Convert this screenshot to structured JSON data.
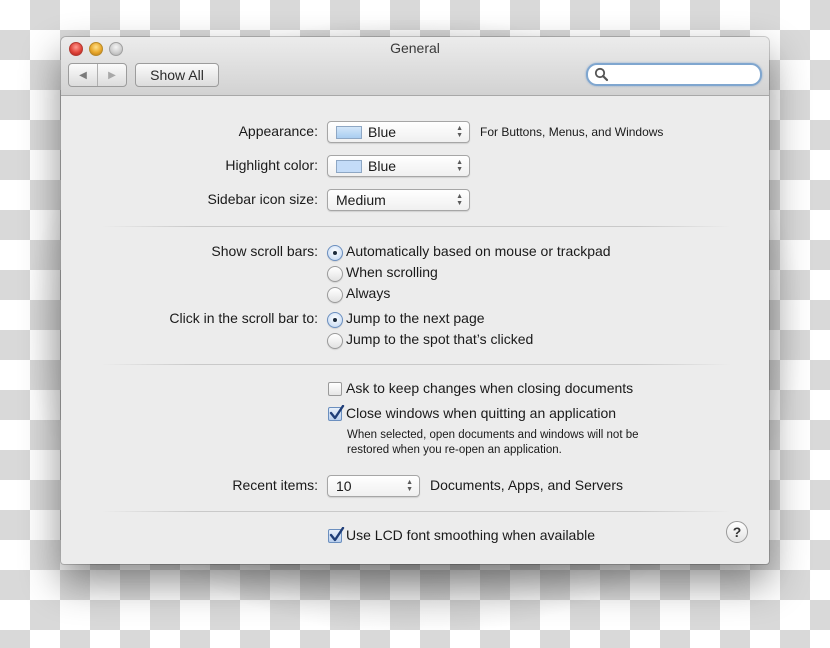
{
  "window": {
    "title": "General",
    "traffic_lights": [
      "close",
      "minimize",
      "zoom"
    ]
  },
  "toolbar": {
    "back_icon": "◀",
    "forward_icon": "▶",
    "show_all_label": "Show All",
    "search": {
      "placeholder": "",
      "value": "",
      "icon": "search-icon"
    }
  },
  "appearance": {
    "label": "Appearance:",
    "value": "Blue",
    "swatch_color": "#a9cdf0",
    "note": "For Buttons, Menus, and Windows"
  },
  "highlight": {
    "label": "Highlight color:",
    "value": "Blue",
    "swatch_color": "#c4dcf8"
  },
  "sidebar_icon_size": {
    "label": "Sidebar icon size:",
    "value": "Medium"
  },
  "scroll_bars": {
    "label": "Show scroll bars:",
    "options": [
      {
        "label": "Automatically based on mouse or trackpad",
        "selected": true
      },
      {
        "label": "When scrolling",
        "selected": false
      },
      {
        "label": "Always",
        "selected": false
      }
    ]
  },
  "click_scroll_bar": {
    "label": "Click in the scroll bar to:",
    "options": [
      {
        "label": "Jump to the next page",
        "selected": true
      },
      {
        "label": "Jump to the spot that’s clicked",
        "selected": false
      }
    ]
  },
  "documents": {
    "ask_keep_changes": {
      "label": "Ask to keep changes when closing documents",
      "checked": false
    },
    "close_windows": {
      "label": "Close windows when quitting an application",
      "checked": true,
      "note_line1": "When selected, open documents and windows will not be",
      "note_line2": "restored when you re-open an application."
    }
  },
  "recent_items": {
    "label": "Recent items:",
    "value": "10",
    "suffix": "Documents, Apps, and Servers"
  },
  "lcd_smoothing": {
    "label": "Use LCD font smoothing when available",
    "checked": true
  },
  "help_label": "?",
  "colors": {
    "search_focus_ring": "#7fa6cf",
    "close_button": "#e0443a",
    "minimize_button": "#e8a72a",
    "zoom_button": "#cfcfcf",
    "window_bg": "#ececec"
  }
}
